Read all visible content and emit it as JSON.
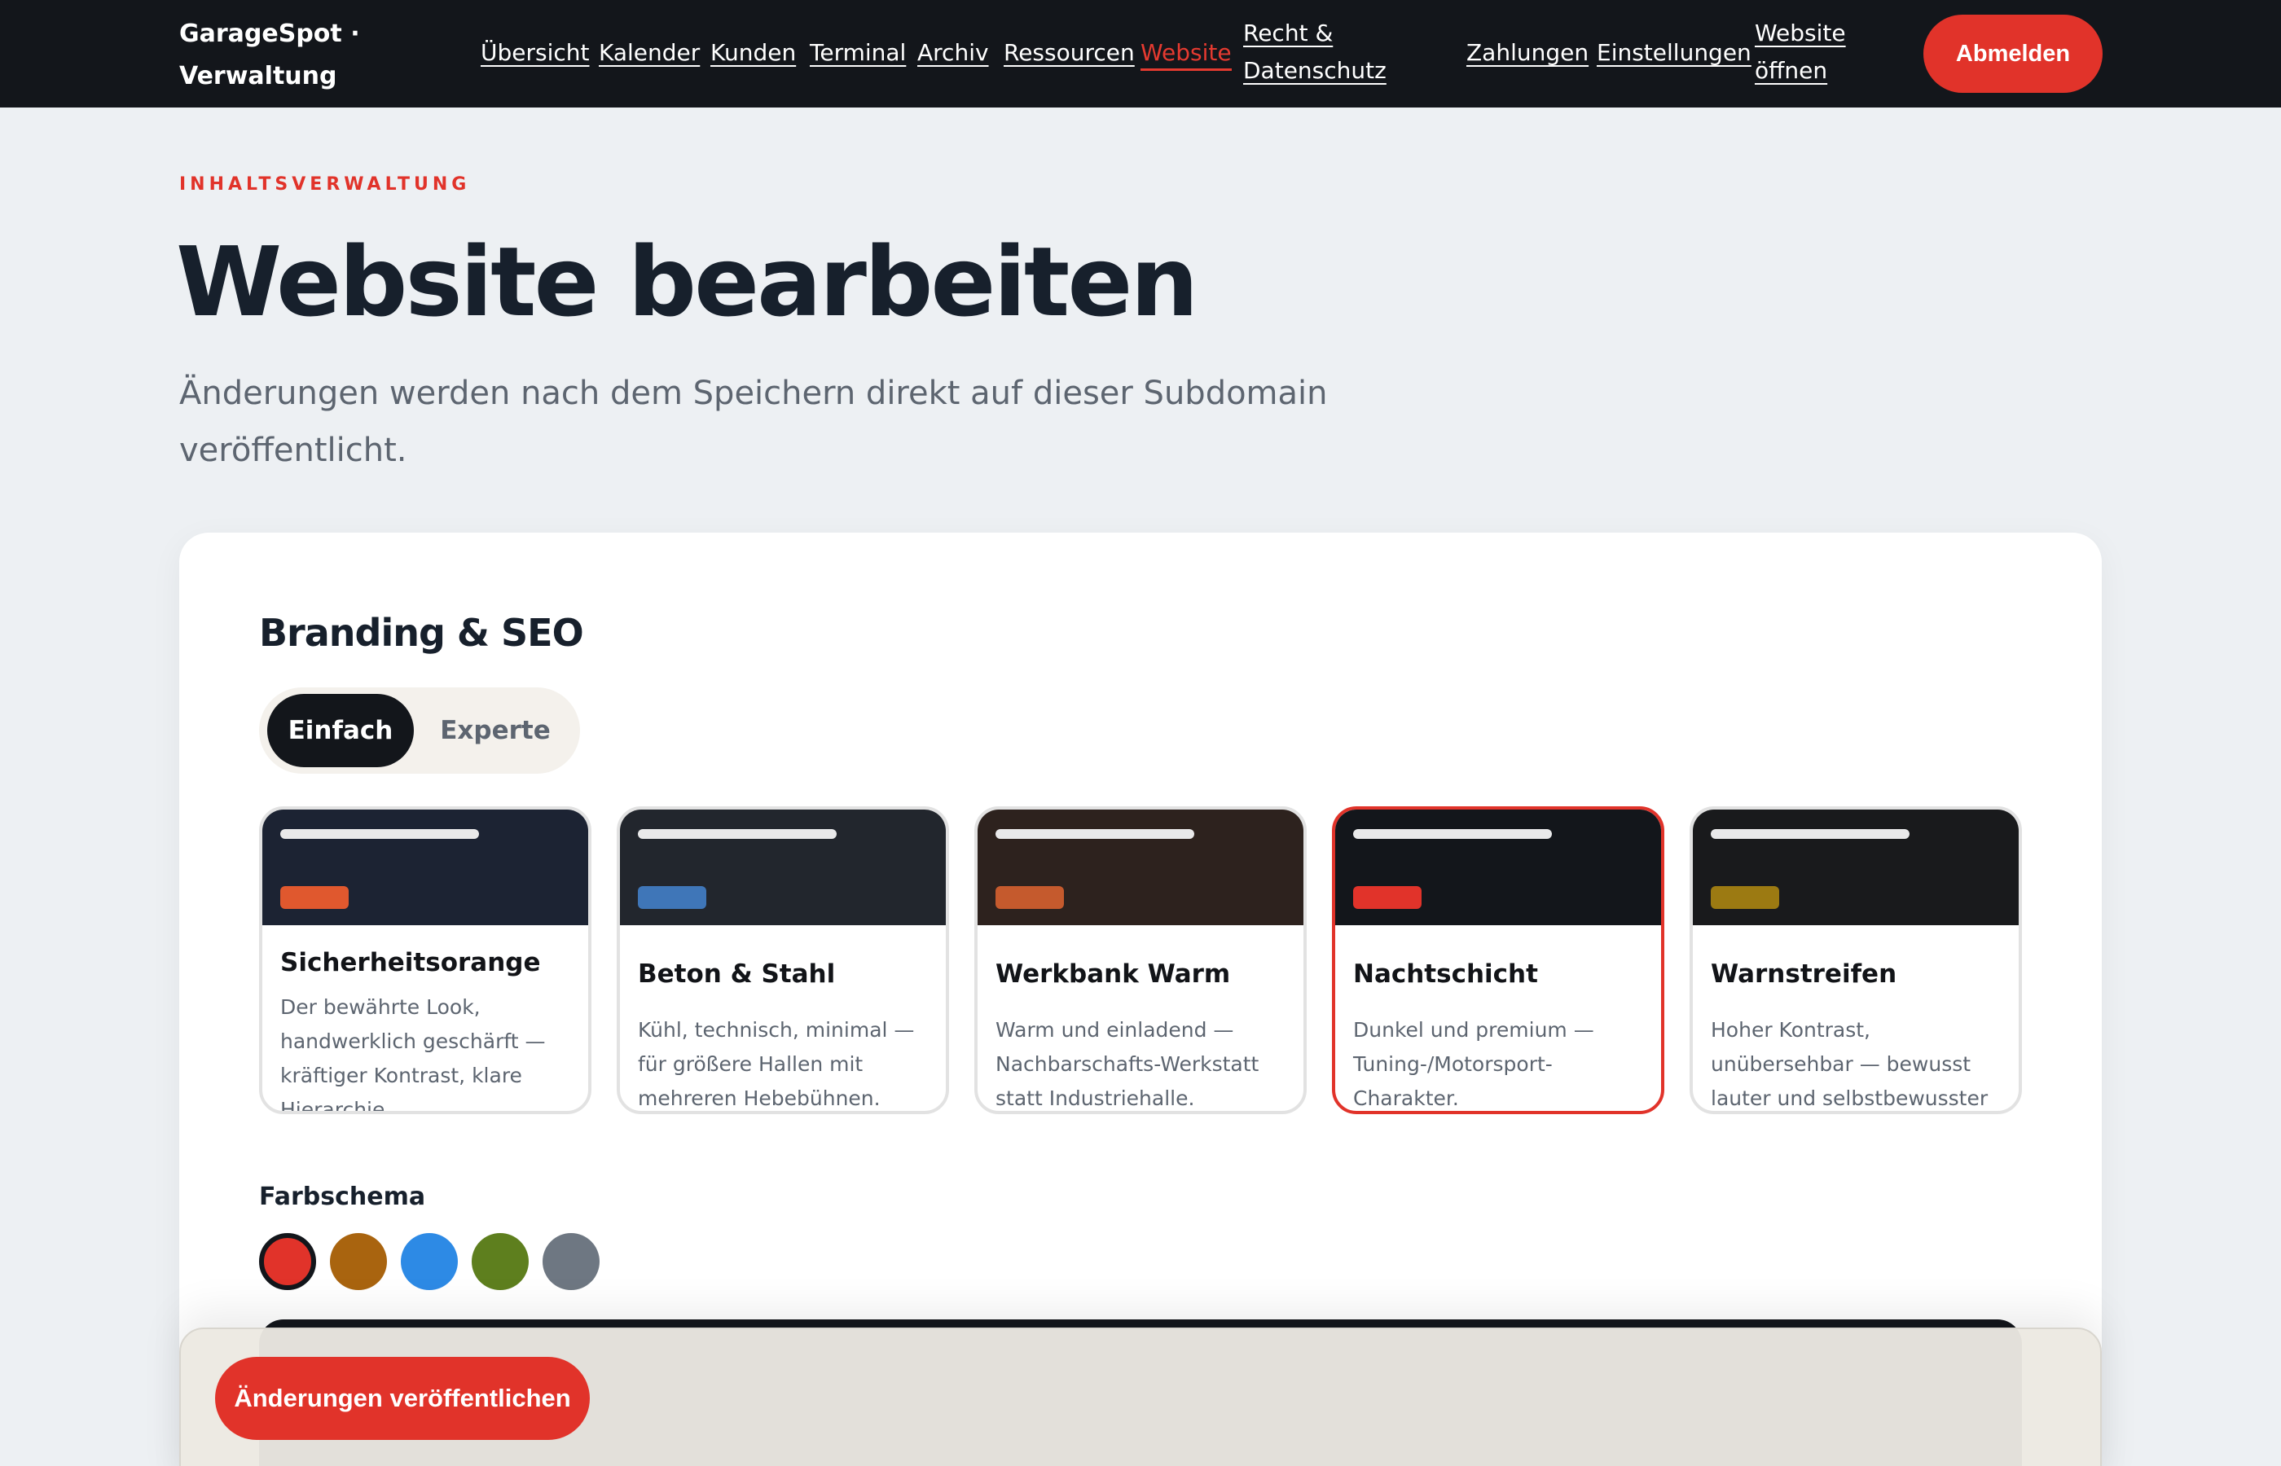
{
  "nav": {
    "brand": "GarageSpot · Verwaltung",
    "links": [
      "Übersicht",
      "Kalender",
      "Kunden",
      "Terminal",
      "Archiv",
      "Ressourcen",
      "Website",
      "Recht & Datenschutz",
      "Zahlungen",
      "Einstellungen",
      "Website öffnen"
    ],
    "active": "Website",
    "logout": "Abmelden"
  },
  "header": {
    "eyebrow": "INHALTSVERWALTUNG",
    "title": "Website bearbeiten",
    "subtitle": "Änderungen werden nach dem Speichern direkt auf dieser Subdomain veröffentlicht."
  },
  "branding": {
    "title": "Branding & SEO",
    "modes": [
      "Einfach",
      "Experte"
    ],
    "active_mode": "Einfach",
    "themes": [
      {
        "name": "Sicherheitsorange",
        "desc": "Der bewährte Look, handwerklich geschärft — kräftiger Kontrast, klare Hierarchie.",
        "bg": "#1c2333",
        "accent": "#e0582e",
        "selected": false
      },
      {
        "name": "Beton & Stahl",
        "desc": "Kühl, technisch, minimal — für größere Hallen mit mehreren Hebebühnen.",
        "bg": "#22262d",
        "accent": "#3f76b8",
        "selected": false
      },
      {
        "name": "Werkbank Warm",
        "desc": "Warm und einladend — Nachbarschafts-Werkstatt statt Industriehalle.",
        "bg": "#2d221e",
        "accent": "#c55a2d",
        "selected": false
      },
      {
        "name": "Nachtschicht",
        "desc": "Dunkel und premium — Tuning-/Motorsport-Charakter.",
        "bg": "#13161b",
        "accent": "#e1332a",
        "selected": true
      },
      {
        "name": "Warnstreifen",
        "desc": "Hoher Kontrast, unübersehbar — bewusst lauter und selbstbewusster Auftritt.",
        "bg": "#191a1c",
        "accent": "#9c7a12",
        "selected": false
      }
    ],
    "color_scheme_label": "Farbschema",
    "swatches": [
      {
        "color": "#e1332a",
        "selected": true
      },
      {
        "color": "#a9640f",
        "selected": false
      },
      {
        "color": "#2d8ae5",
        "selected": false
      },
      {
        "color": "#5e7f1e",
        "selected": false
      },
      {
        "color": "#6e7782",
        "selected": false
      }
    ]
  },
  "footer": {
    "publish": "Änderungen veröffentlichen"
  }
}
